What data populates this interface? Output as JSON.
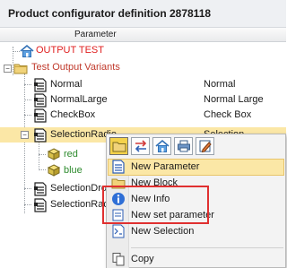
{
  "window": {
    "title": "Product configurator definition 2878118"
  },
  "header": {
    "column_label": "Parameter"
  },
  "tree": [
    {
      "label": "OUTPUT TEST",
      "value": "",
      "icon": "home-icon",
      "color": "#e02020"
    },
    {
      "label": "Test Output Variants",
      "value": "",
      "icon": "folder-icon",
      "color": "#c0392b"
    },
    {
      "label": "Normal",
      "value": "Normal",
      "icon": "document-icon"
    },
    {
      "label": "NormalLarge",
      "value": "Normal Large",
      "icon": "document-icon"
    },
    {
      "label": "CheckBox",
      "value": "Check Box",
      "icon": "document-icon"
    },
    {
      "label": "SelectionRadio",
      "value": "Selection",
      "icon": "document-icon",
      "selected": true
    },
    {
      "label": "red",
      "value": "",
      "icon": "cube-icon",
      "color": "#2e8b2e"
    },
    {
      "label": "blue",
      "value": "",
      "icon": "cube-icon",
      "color": "#2e8b2e"
    },
    {
      "label": "SelectionDropd",
      "value": "",
      "icon": "document-icon"
    },
    {
      "label": "SelectionRadio",
      "value": "",
      "icon": "document-icon"
    }
  ],
  "context_menu": {
    "toolbar": [
      "folder-icon",
      "swap-icon",
      "home-icon",
      "printer-icon",
      "edit-icon"
    ],
    "items": [
      {
        "label": "New Parameter",
        "icon": "document-icon"
      },
      {
        "label": "New Block",
        "icon": "folder-icon"
      },
      {
        "label": "New Info",
        "icon": "info-icon"
      },
      {
        "label": "New set parameter",
        "icon": "set-parameter-icon"
      },
      {
        "label": "New Selection",
        "icon": "selection-icon"
      },
      {
        "label": "Copy",
        "icon": "copy-icon"
      }
    ]
  },
  "colors": {
    "selection": "#fbe7a6",
    "annotation": "#e03030"
  }
}
